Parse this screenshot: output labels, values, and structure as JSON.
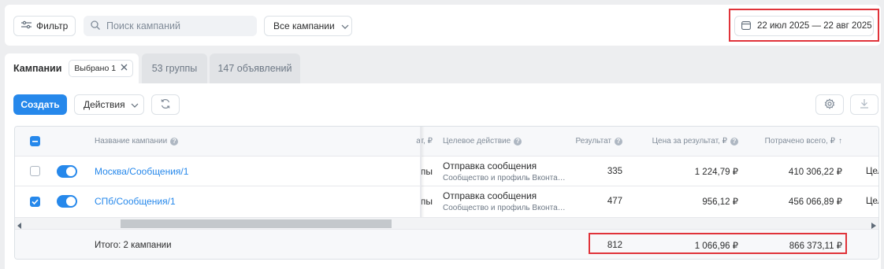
{
  "topbar": {
    "filter_label": "Фильтр",
    "search_placeholder": "Поиск кампаний",
    "campaign_select": "Все кампании",
    "date_range": "22 июл 2025 — 22 авг 2025"
  },
  "tabs": {
    "campaigns": "Кампании",
    "selected_chip": "Выбрано 1",
    "groups": "53 группы",
    "ads": "147 объявлений"
  },
  "toolbar": {
    "create": "Создать",
    "actions": "Действия"
  },
  "table": {
    "headers": {
      "name": "Название кампании",
      "clipped": "ат, ₽",
      "target_action": "Целевое действие",
      "result": "Результат",
      "price_per_result": "Цена за результат, ₽",
      "spent_total": "Потрачено всего, ₽",
      "sort_arrow": "↑"
    },
    "rows": [
      {
        "checked": false,
        "enabled": true,
        "name": "Москва/Сообщения/1",
        "clipped": "пы",
        "target_action": "Отправка сообщения",
        "target_sub": "Сообщество и профиль Вконта…",
        "result": "335",
        "price": "1 224,79 ₽",
        "spent": "410 306,22 ₽",
        "next_col": "Цел"
      },
      {
        "checked": true,
        "enabled": true,
        "name": "СПб/Сообщения/1",
        "clipped": "пы",
        "target_action": "Отправка сообщения",
        "target_sub": "Сообщество и профиль Вконта…",
        "result": "477",
        "price": "956,12 ₽",
        "spent": "456 066,89 ₽",
        "next_col": "Цел"
      }
    ],
    "totals": {
      "label": "Итого: 2 кампании",
      "result": "812",
      "price": "1 066,96 ₽",
      "spent": "866 373,11 ₽"
    }
  },
  "colors": {
    "accent": "#2688eb",
    "highlight": "#e0333a",
    "background": "#edeef0"
  }
}
